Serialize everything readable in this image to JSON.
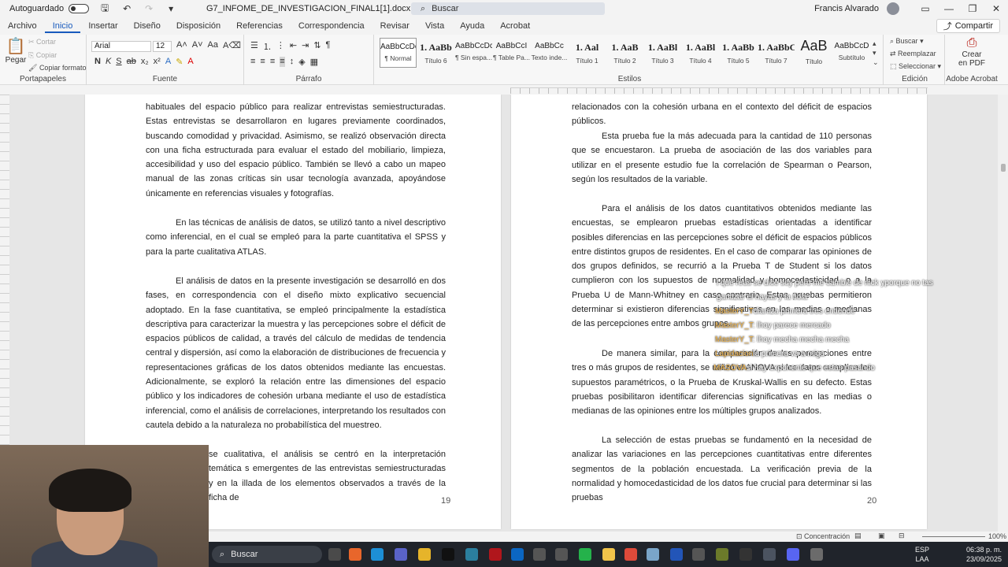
{
  "titlebar": {
    "autosave_label": "Autoguardado",
    "doc_title": "G7_INFOME_DE_INVESTIGACION_FINAL1[1].docx",
    "search_placeholder": "Buscar",
    "user_name": "Francis Alvarado"
  },
  "menu": {
    "tabs": [
      "Archivo",
      "Inicio",
      "Insertar",
      "Diseño",
      "Disposición",
      "Referencias",
      "Correspondencia",
      "Revisar",
      "Vista",
      "Ayuda",
      "Acrobat"
    ],
    "active": "Inicio",
    "share_label": "Compartir"
  },
  "ribbon": {
    "clipboard": {
      "paste": "Pegar",
      "cut": "Cortar",
      "copy": "Copiar",
      "format_painter": "Copiar formato",
      "label": "Portapapeles"
    },
    "font": {
      "name": "Arial",
      "size": "12",
      "label": "Fuente"
    },
    "paragraph": {
      "label": "Párrafo"
    },
    "styles": {
      "label": "Estilos",
      "items": [
        {
          "preview": "AaBbCcDc",
          "name": "¶ Normal"
        },
        {
          "preview": "1. AaBb",
          "name": "Título 6"
        },
        {
          "preview": "AaBbCcDc",
          "name": "¶ Sin espa..."
        },
        {
          "preview": "AaBbCcI",
          "name": "¶ Table Pa..."
        },
        {
          "preview": "AaBbCc",
          "name": "Texto inde..."
        },
        {
          "preview": "1. Aal",
          "name": "Título 1"
        },
        {
          "preview": "1. AaB",
          "name": "Título 2"
        },
        {
          "preview": "1. AaBl",
          "name": "Título 3"
        },
        {
          "preview": "1. AaBl",
          "name": "Título 4"
        },
        {
          "preview": "1. AaBb",
          "name": "Título 5"
        },
        {
          "preview": "1. AaBbC",
          "name": "Título 7"
        },
        {
          "preview": "AaB",
          "name": "Título"
        },
        {
          "preview": "AaBbCcD",
          "name": "Subtítulo"
        }
      ]
    },
    "editing": {
      "find": "Buscar",
      "replace": "Reemplazar",
      "select": "Seleccionar",
      "label": "Edición"
    },
    "acrobat": {
      "create": "Crear",
      "pdf": "en PDF",
      "label": "Adobe Acrobat"
    }
  },
  "page_left": {
    "p1": "habituales del espacio público para realizar entrevistas semiestructuradas. Estas entrevistas se desarrollaron en lugares previamente coordinados, buscando comodidad y privacidad. Asimismo, se realizó observación directa con una ficha estructurada para evaluar el estado del mobiliario, limpieza, accesibilidad y uso del espacio público. También se llevó a cabo un mapeo manual de las zonas críticas sin usar tecnología avanzada, apoyándose únicamente en referencias visuales y fotografías.",
    "p2": "En las técnicas de análisis de datos, se utilizó tanto a nivel descriptivo como inferencial, en el cual se empleó para la parte cuantitativa el SPSS y para la parte cualitativa ATLAS.",
    "p3": "El análisis de datos en la presente investigación se desarrolló en dos fases, en correspondencia con el diseño mixto explicativo secuencial adoptado. En la fase cuantitativa, se empleó principalmente la estadística descriptiva para caracterizar la muestra y las percepciones sobre el déficit de espacios públicos de calidad, a través del cálculo de medidas de tendencia central y dispersión, así como la elaboración de distribuciones de frecuencia y representaciones gráficas de los datos obtenidos mediante las encuestas. Adicionalmente, se exploró la relación entre las dimensiones del espacio público y los indicadores de cohesión urbana mediante el uso de estadística inferencial, como el análisis de correlaciones, interpretando los resultados con cautela debido a la naturaleza no probabilística del muestreo.",
    "p4": "se cualitativa, el análisis se centró en la interpretación temática s emergentes de las entrevistas semiestructuradas y en la illada de los elementos observados a través de la ficha de",
    "page_number": "19"
  },
  "page_right": {
    "p1": "relacionados con la cohesión urbana en el contexto del déficit de espacios públicos.",
    "p2": "Esta prueba fue la más adecuada para la cantidad de 110 personas que se encuestaron. La prueba de asociación de las dos variables para utilizar en el presente estudio fue la correlación de Spearman o Pearson, según los resultados de la variable.",
    "p3": "Para el análisis de los datos cuantitativos obtenidos mediante las encuestas, se emplearon pruebas estadísticas orientadas a identificar posibles diferencias en las percepciones sobre el déficit de espacios públicos entre distintos grupos de residentes. En el caso de comparar las opiniones de dos grupos definidos, se recurrió a la Prueba T de Student si los datos cumplieron con los supuestos de normalidad y homocedasticidad, o a la Prueba U de Mann-Whitney en caso contrario. Estas pruebas permitieron determinar si existieron diferencias significativas en las medias o medianas de las percepciones entre ambos grupos.",
    "p4": "De manera similar, para la comparación de las percepciones entre tres o más grupos de residentes, se utilizó el ANOVA si los datos cumplían los supuestos paramétricos, o la Prueba de Kruskal-Wallis en su defecto. Estas pruebas posibilitaron identificar diferencias significativas en las medias o medianas de las opiniones entre los múltiples grupos analizados.",
    "p5": "La selección de estas pruebas se fundamentó en la necesidad de analizar las variaciones en las percepciones cuantitativas entre diferentes segmentos de la población encuestada. La verificación previa de la normalidad y homocedasticidad de los datos fue crucial para determinar si las pruebas",
    "page_number": "20"
  },
  "chat": [
    {
      "user": "",
      "text": "l que reus se dice soy pero me cambie de nick yporque no tas"
    },
    {
      "user": "",
      "text": "gantizar el hayas y la fiola"
    },
    {
      "user": "MasterY_T",
      "text": "dianiza primera tres entiende"
    },
    {
      "user": "MasterY_T",
      "text": ": lhoy parece mercado"
    },
    {
      "user": "MasterY_T",
      "text": ": lhoy mecha mecha mecha"
    },
    {
      "user": "Lapidacion",
      "text": "la primera va a miga"
    },
    {
      "user": "MASOVA",
      "text": "si hay exponente que estas pasando"
    }
  ],
  "statusbar": {
    "focus": "Concentración",
    "zoom": "100%"
  },
  "taskbar": {
    "search": "Buscar",
    "lang1": "ESP",
    "lang2": "LAA",
    "time": "06:38 p. m.",
    "date": "23/09/2025"
  }
}
